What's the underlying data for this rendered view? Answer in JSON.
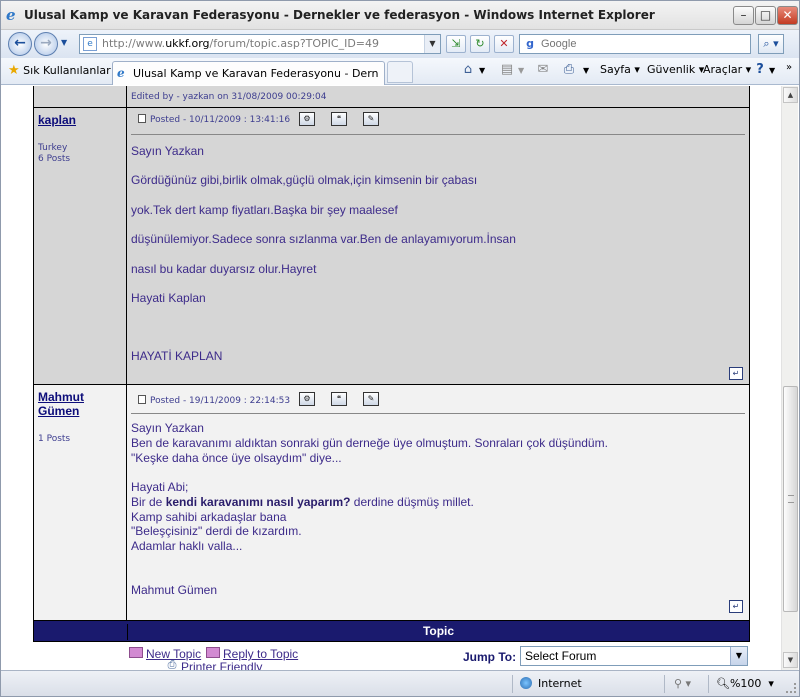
{
  "window": {
    "title": "Ulusal Kamp ve Karavan Federasyonu - Dernekler ve federasyon - Windows Internet Explorer",
    "controls": [
      "minimize",
      "maximize",
      "close"
    ]
  },
  "navbar": {
    "url_prefix": "http://www.",
    "url_domain": "ukkf.org",
    "url_rest": "/forum/topic.asp?TOPIC_ID=49",
    "search_placeholder": "Google"
  },
  "tabbar": {
    "favorites_label": "Sık Kullanılanlar",
    "tab_title": "Ulusal Kamp ve Karavan Federasyonu - Dernekler ve f...",
    "page_menu": "Sayfa",
    "security_menu": "Güvenlik",
    "tools_menu": "Araçlar"
  },
  "forum": {
    "edited_note": "Edited by - yazkan on 31/08/2009 00:29:04",
    "posts": [
      {
        "author": "kaplan",
        "location": "Turkey",
        "post_count": "6 Posts",
        "posted": "Posted - 10/11/2009 :  13:41:16",
        "lines": [
          "Sayın Yazkan",
          "Gördüğünüz gibi,birlik olmak,güçlü olmak,için kimsenin bir çabası",
          "yok.Tek dert kamp fiyatları.Başka bir şey maalesef",
          "düşünülemiyor.Sadece sonra sızlanma var.Ben de anlayamıyorum.İnsan",
          "nasıl bu kadar duyarsız olur.Hayret",
          "Hayati Kaplan",
          "HAYATİ KAPLAN"
        ]
      },
      {
        "author_line1": "Mahmut",
        "author_line2": "Gümen",
        "post_count": "1 Posts",
        "posted": "Posted - 19/11/2009 :  22:14:53",
        "lines": [
          "Sayın Yazkan",
          "Ben de karavanımı aldıktan sonraki gün derneğe üye olmuştum. Sonraları çok düşündüm.",
          "\"Keşke daha önce üye olsaydım\" diye...",
          "Hayati Abi;",
          "Bir de ",
          "kendi karavanımı nasıl yaparım?",
          " derdine düşmüş millet.",
          "Kamp sahibi arkadaşlar bana",
          "\"Beleşçisiniz\" derdi de kızardım.",
          "Adamlar haklı valla...",
          "Mahmut Gümen"
        ]
      }
    ],
    "topic_bar": "Topic",
    "new_topic": "New Topic",
    "reply_topic": "Reply to Topic",
    "printer_friendly": "Printer Friendly",
    "jump_label": "Jump To:",
    "jump_value": "Select Forum"
  },
  "status": {
    "zone": "Internet",
    "zoom": "%100"
  },
  "colors": {
    "post_bg": "#d6d6d6",
    "post_bg_alt": "#f2f2f2",
    "topic_bar": "#1a1a6e",
    "text": "#3d2b8a"
  },
  "icons": [
    "ie-icon",
    "back-icon",
    "forward-icon",
    "favicon-icon",
    "refresh-icon",
    "stop-icon",
    "google-icon",
    "search-icon",
    "star-icon",
    "home-icon",
    "rss-icon",
    "mail-icon",
    "print-icon",
    "help-icon",
    "edit-icon",
    "quote-icon",
    "folder-icon",
    "globe-icon"
  ]
}
